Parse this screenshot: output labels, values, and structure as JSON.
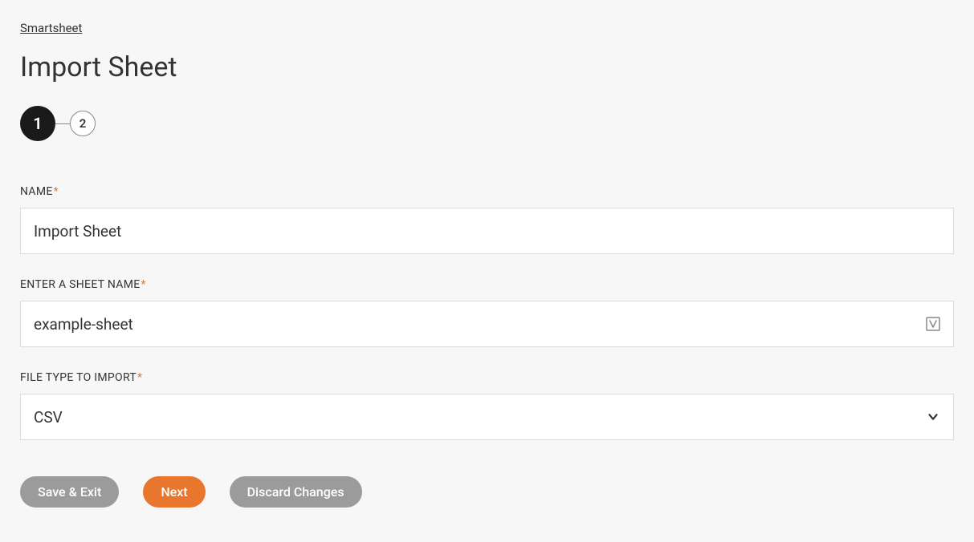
{
  "breadcrumb": {
    "label": "Smartsheet"
  },
  "page": {
    "title": "Import Sheet"
  },
  "stepper": {
    "steps": [
      "1",
      "2"
    ],
    "activeIndex": 0
  },
  "form": {
    "name": {
      "label": "NAME",
      "required": "*",
      "value": "Import Sheet"
    },
    "sheetName": {
      "label": "ENTER A SHEET NAME",
      "required": "*",
      "value": "example-sheet"
    },
    "fileType": {
      "label": "FILE TYPE TO IMPORT",
      "required": "*",
      "selected": "CSV"
    }
  },
  "buttons": {
    "saveExit": "Save & Exit",
    "next": "Next",
    "discard": "Discard Changes"
  }
}
